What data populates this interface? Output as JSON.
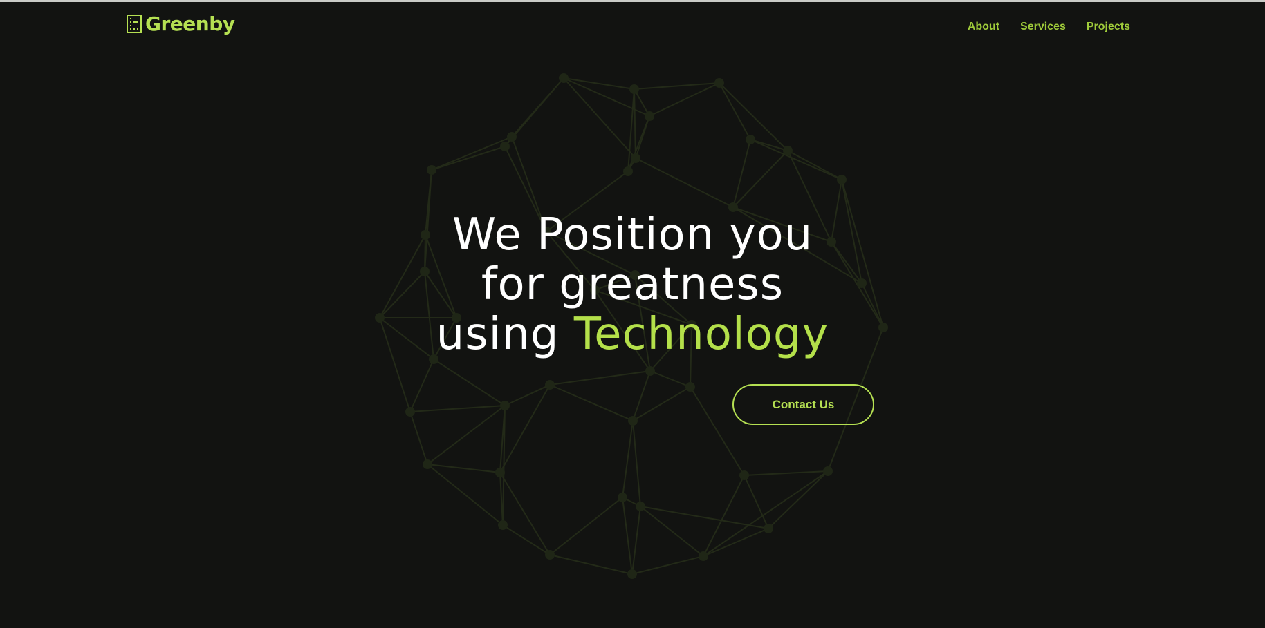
{
  "header": {
    "logo_icon": "building-logo-icon",
    "logo_text": "Greenby",
    "nav": [
      "About",
      "Services",
      "Projects"
    ]
  },
  "hero": {
    "line1": "We Position you",
    "line2": "for greatness",
    "line3_prefix": "using ",
    "line3_accent": "Technology",
    "cta_label": "Contact Us"
  },
  "colors": {
    "background": "#121311",
    "accent": "#b5e052",
    "nav_text": "#9fcb3a",
    "network_lines": "#232a18"
  }
}
